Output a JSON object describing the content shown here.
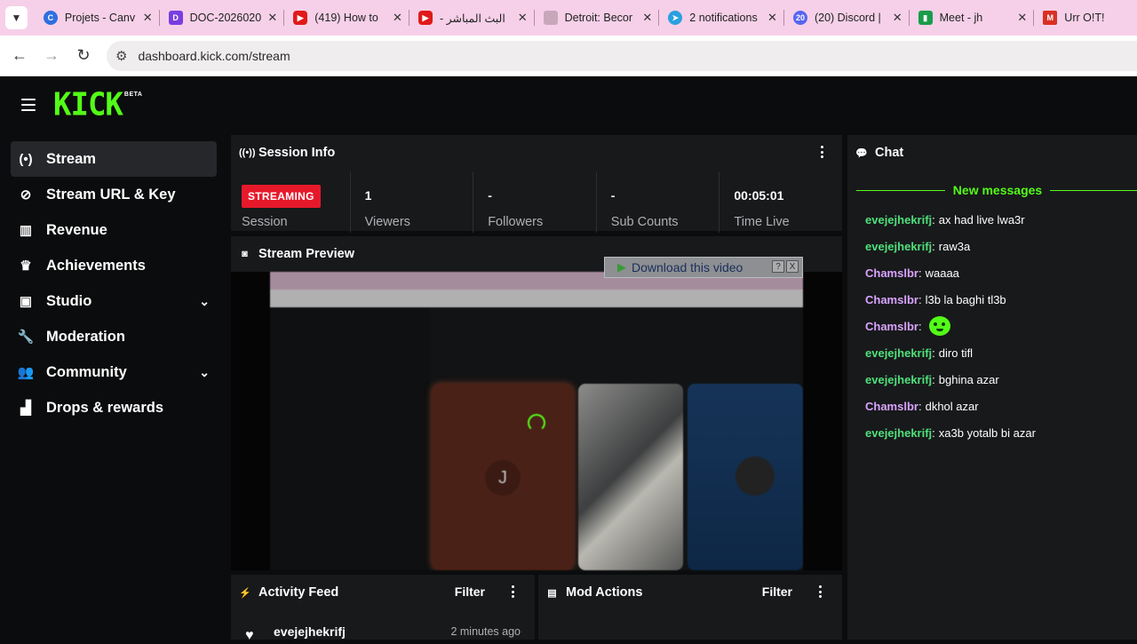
{
  "browser": {
    "tabs": [
      {
        "title": "Projets - Canv",
        "icon": "canva-icon",
        "color": "#2f6fe0"
      },
      {
        "title": "DOC-2026020",
        "icon": "doc-icon",
        "color": "#7a3ee0"
      },
      {
        "title": "(419) How to",
        "icon": "youtube-icon",
        "color": "#e01a1a"
      },
      {
        "title": "البث المباشر -",
        "icon": "youtube-icon",
        "color": "#e01a1a"
      },
      {
        "title": "Detroit: Becor",
        "icon": "page-icon",
        "color": "#c9a7bb"
      },
      {
        "title": "2 notifications",
        "icon": "telegram-icon",
        "color": "#2aa0e0"
      },
      {
        "title": "(20) Discord |",
        "icon": "discord-icon",
        "color": "#5865f2"
      },
      {
        "title": "Meet - jh",
        "icon": "meet-icon",
        "color": "#1a9c4a"
      },
      {
        "title": "Urr O!T!",
        "icon": "gmail-icon",
        "color": "#d93025"
      }
    ],
    "discord_badge": "20",
    "url": "dashboard.kick.com/stream"
  },
  "brand": {
    "logo": "KICK",
    "beta": "BETA",
    "accent": "#53fc18"
  },
  "sidebar": {
    "items": [
      {
        "label": "Stream",
        "icon": "stream-icon"
      },
      {
        "label": "Stream URL & Key",
        "icon": "link-icon"
      },
      {
        "label": "Revenue",
        "icon": "revenue-icon"
      },
      {
        "label": "Achievements",
        "icon": "trophy-icon"
      },
      {
        "label": "Studio",
        "icon": "studio-icon"
      },
      {
        "label": "Moderation",
        "icon": "wrench-icon"
      },
      {
        "label": "Community",
        "icon": "community-icon"
      },
      {
        "label": "Drops & rewards",
        "icon": "drops-icon"
      }
    ]
  },
  "session": {
    "title": "Session Info",
    "status": "STREAMING",
    "stats": [
      {
        "value": "",
        "label": "Session"
      },
      {
        "value": "1",
        "label": "Viewers"
      },
      {
        "value": "-",
        "label": "Followers"
      },
      {
        "value": "-",
        "label": "Sub Counts"
      },
      {
        "value": "00:05:01",
        "label": "Time Live"
      }
    ]
  },
  "preview": {
    "title": "Stream Preview",
    "download_label": "Download this video",
    "help": "?",
    "close": "X",
    "card_letter": "J"
  },
  "activity": {
    "title": "Activity Feed",
    "filter": "Filter",
    "items": [
      {
        "user": "evejejhekrifj",
        "time": "2 minutes ago"
      }
    ]
  },
  "mod": {
    "title": "Mod Actions",
    "filter": "Filter"
  },
  "chat": {
    "title": "Chat",
    "new_messages": "New messages",
    "messages": [
      {
        "user": "evejejhekrifj",
        "text": "ax had live lwa3r",
        "color": "#4fe07a"
      },
      {
        "user": "evejejhekrifj",
        "text": "raw3a",
        "color": "#4fe07a"
      },
      {
        "user": "Chamslbr",
        "text": "waaaa",
        "color": "#d9a3ff"
      },
      {
        "user": "Chamslbr",
        "text": "l3b la baghi tl3b",
        "color": "#d9a3ff"
      },
      {
        "user": "Chamslbr",
        "text": "",
        "color": "#d9a3ff",
        "emote": "frog-emote-icon"
      },
      {
        "user": "evejejhekrifj",
        "text": "diro tifl",
        "color": "#4fe07a"
      },
      {
        "user": "evejejhekrifj",
        "text": "bghina azar",
        "color": "#4fe07a"
      },
      {
        "user": "Chamslbr",
        "text": "dkhol azar",
        "color": "#d9a3ff"
      },
      {
        "user": "evejejhekrifj",
        "text": "xa3b yotalb bi azar",
        "color": "#4fe07a"
      }
    ]
  }
}
